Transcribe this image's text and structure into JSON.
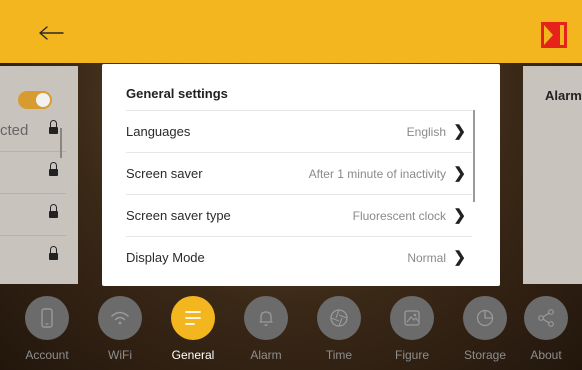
{
  "colors": {
    "accent": "#f4b61f",
    "brand_red": "#e5231b",
    "nav_inactive": "#6b6b6b"
  },
  "header": {
    "back_icon": "back-arrow-icon",
    "logo": "kodak-logo"
  },
  "left_panel": {
    "toggle_on": true,
    "row_text": "cted"
  },
  "right_panel": {
    "title": "Alarm"
  },
  "dialog": {
    "title": "General settings",
    "rows": [
      {
        "label": "Languages",
        "value": "English"
      },
      {
        "label": "Screen saver",
        "value": "After 1 minute of inactivity"
      },
      {
        "label": "Screen saver type",
        "value": "Fluorescent clock"
      },
      {
        "label": "Display Mode",
        "value": "Normal"
      }
    ]
  },
  "nav": {
    "active": "General",
    "items": [
      {
        "label": "Account",
        "icon": "phone-icon"
      },
      {
        "label": "WiFi",
        "icon": "wifi-icon"
      },
      {
        "label": "General",
        "icon": "menu-lines-icon"
      },
      {
        "label": "Alarm",
        "icon": "bell-icon"
      },
      {
        "label": "Time",
        "icon": "aperture-icon"
      },
      {
        "label": "Figure",
        "icon": "image-icon"
      },
      {
        "label": "Storage",
        "icon": "pie-chart-icon"
      },
      {
        "label": "About",
        "icon": "share-icon"
      }
    ]
  }
}
